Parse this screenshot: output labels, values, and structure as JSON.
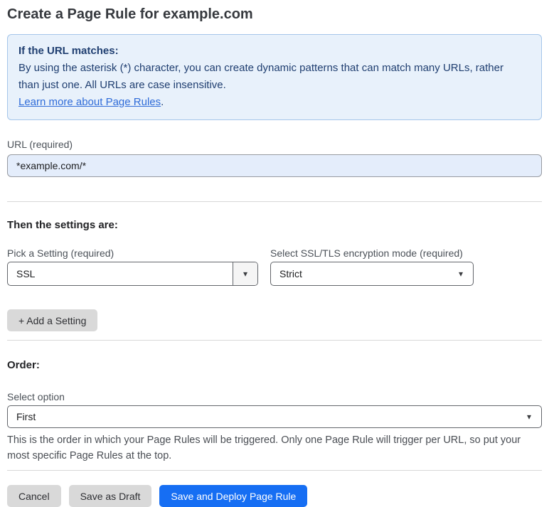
{
  "page": {
    "title": "Create a Page Rule for example.com"
  },
  "info_box": {
    "heading": "If the URL matches:",
    "body": "By using the asterisk (*) character, you can create dynamic patterns that can match many URLs, rather than just one. All URLs are case insensitive.",
    "link_label": "Learn more about Page Rules",
    "link_suffix": "."
  },
  "url_field": {
    "label": "URL (required)",
    "value": "*example.com/*"
  },
  "settings": {
    "heading": "Then the settings are:",
    "setting_select": {
      "label": "Pick a Setting (required)",
      "value": "SSL"
    },
    "mode_select": {
      "label": "Select SSL/TLS encryption mode (required)",
      "value": "Strict"
    },
    "add_button_label": "+ Add a Setting"
  },
  "order": {
    "heading": "Order:",
    "select_label": "Select option",
    "value": "First",
    "help": "This is the order in which your Page Rules will be triggered. Only one Page Rule will trigger per URL, so put your most specific Page Rules at the top."
  },
  "footer": {
    "cancel_label": "Cancel",
    "save_draft_label": "Save as Draft",
    "save_deploy_label": "Save and Deploy Page Rule"
  },
  "icons": {
    "dropdown_arrow": "▾"
  },
  "colors": {
    "accent_blue": "#166ef3",
    "info_bg": "#e8f1fb",
    "info_border": "#a5c6ea",
    "info_text": "#1f3e70",
    "link_blue": "#2e6bd8",
    "input_highlight_bg": "#e4edfb",
    "button_gray": "#d9d9d9"
  }
}
